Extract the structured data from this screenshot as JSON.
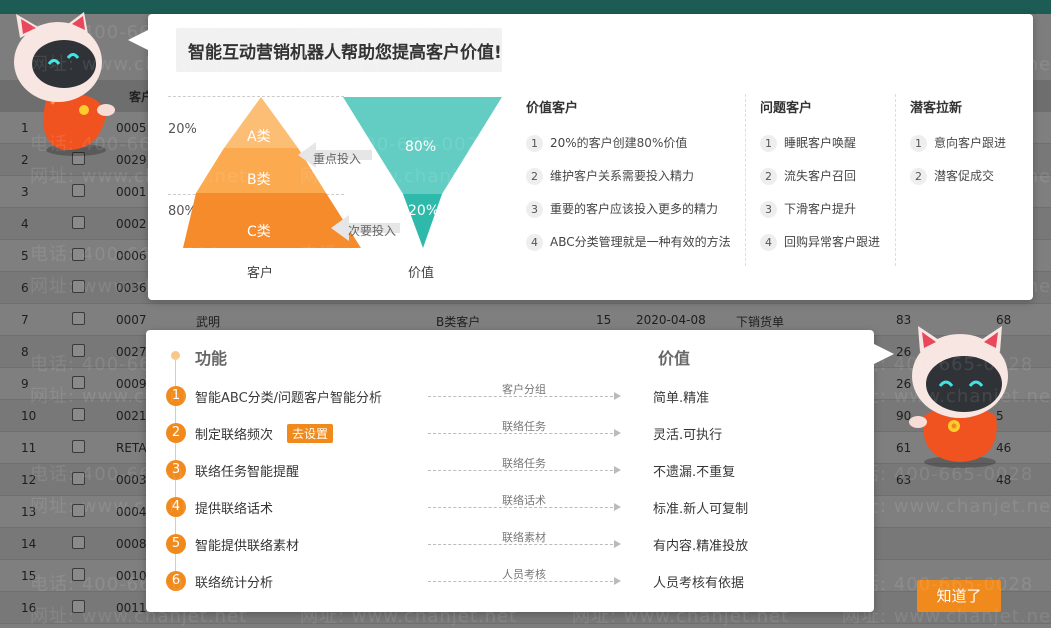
{
  "dialog": {
    "title": "智能互动营销机器人帮助您提高客户价值!",
    "pyramid": {
      "pct_top": "20%",
      "pct_bottom": "80%",
      "levels": [
        "A类",
        "B类",
        "C类"
      ],
      "left_axis": "客户",
      "right_axis": "价值",
      "tri_top": "80%",
      "tri_bottom": "20%",
      "arrow_top": "重点投入",
      "arrow_bottom": "次要投入"
    },
    "columns": [
      {
        "heading": "价值客户",
        "items": [
          "20%的客户创建80%价值",
          "维护客户关系需要投入精力",
          "重要的客户应该投入更多的精力",
          "ABC分类管理就是一种有效的方法"
        ]
      },
      {
        "heading": "问题客户",
        "items": [
          "睡眠客户唤醒",
          "流失客户召回",
          "下滑客户提升",
          "回购异常客户跟进"
        ]
      },
      {
        "heading": "潜客拉新",
        "items": [
          "意向客户跟进",
          "潜客促成交"
        ]
      }
    ],
    "features": {
      "col_func": "功能",
      "col_value": "价值",
      "action_tag": "去设置",
      "rows": [
        {
          "num": "1",
          "feature": "智能ABC分类/问题客户智能分析",
          "flow": "客户分组",
          "value": "简单.精准"
        },
        {
          "num": "2",
          "feature": "制定联络频次",
          "flow": "联络任务",
          "value": "灵活.可执行"
        },
        {
          "num": "3",
          "feature": "联络任务智能提醒",
          "flow": "联络任务",
          "value": "不遗漏.不重复"
        },
        {
          "num": "4",
          "feature": "提供联络话术",
          "flow": "联络话术",
          "value": "标准.新人可复制"
        },
        {
          "num": "5",
          "feature": "智能提供联络素材",
          "flow": "联络素材",
          "value": "有内容.精准投放"
        },
        {
          "num": "6",
          "feature": "联络统计分析",
          "flow": "人员考核",
          "value": "人员考核有依据"
        }
      ]
    },
    "confirm_button": "知道了"
  },
  "watermark": {
    "phone": "电话: 400-665-0028",
    "site": "网址: www.chanjet.net"
  },
  "background_table": {
    "header_customer": "客户",
    "rows": [
      {
        "index": "1",
        "code": "0005"
      },
      {
        "index": "2",
        "code": "0029"
      },
      {
        "index": "3",
        "code": "0001"
      },
      {
        "index": "4",
        "code": "0002"
      },
      {
        "index": "5",
        "code": "0006"
      },
      {
        "index": "6",
        "code": "0036"
      },
      {
        "index": "7",
        "code": "0007",
        "name": "武明",
        "category": "B类客户",
        "count": "15",
        "date": "2020-04-08",
        "type": "下销货单",
        "v1": "83",
        "v2": "68"
      },
      {
        "index": "8",
        "code": "0027",
        "v1": "26"
      },
      {
        "index": "9",
        "code": "0009",
        "v1": "26"
      },
      {
        "index": "10",
        "code": "0021",
        "v1": "90",
        "v2": "5"
      },
      {
        "index": "11",
        "code": "RETA",
        "v1": "61",
        "v2": "46"
      },
      {
        "index": "12",
        "code": "0003",
        "v1": "63",
        "v2": "48"
      },
      {
        "index": "13",
        "code": "0004"
      },
      {
        "index": "14",
        "code": "0008"
      },
      {
        "index": "15",
        "code": "0010"
      },
      {
        "index": "16",
        "code": "0011"
      }
    ]
  },
  "colors": {
    "accent": "#f08a1c",
    "teal": "#3dbfb0",
    "header": "#1c5c55"
  }
}
